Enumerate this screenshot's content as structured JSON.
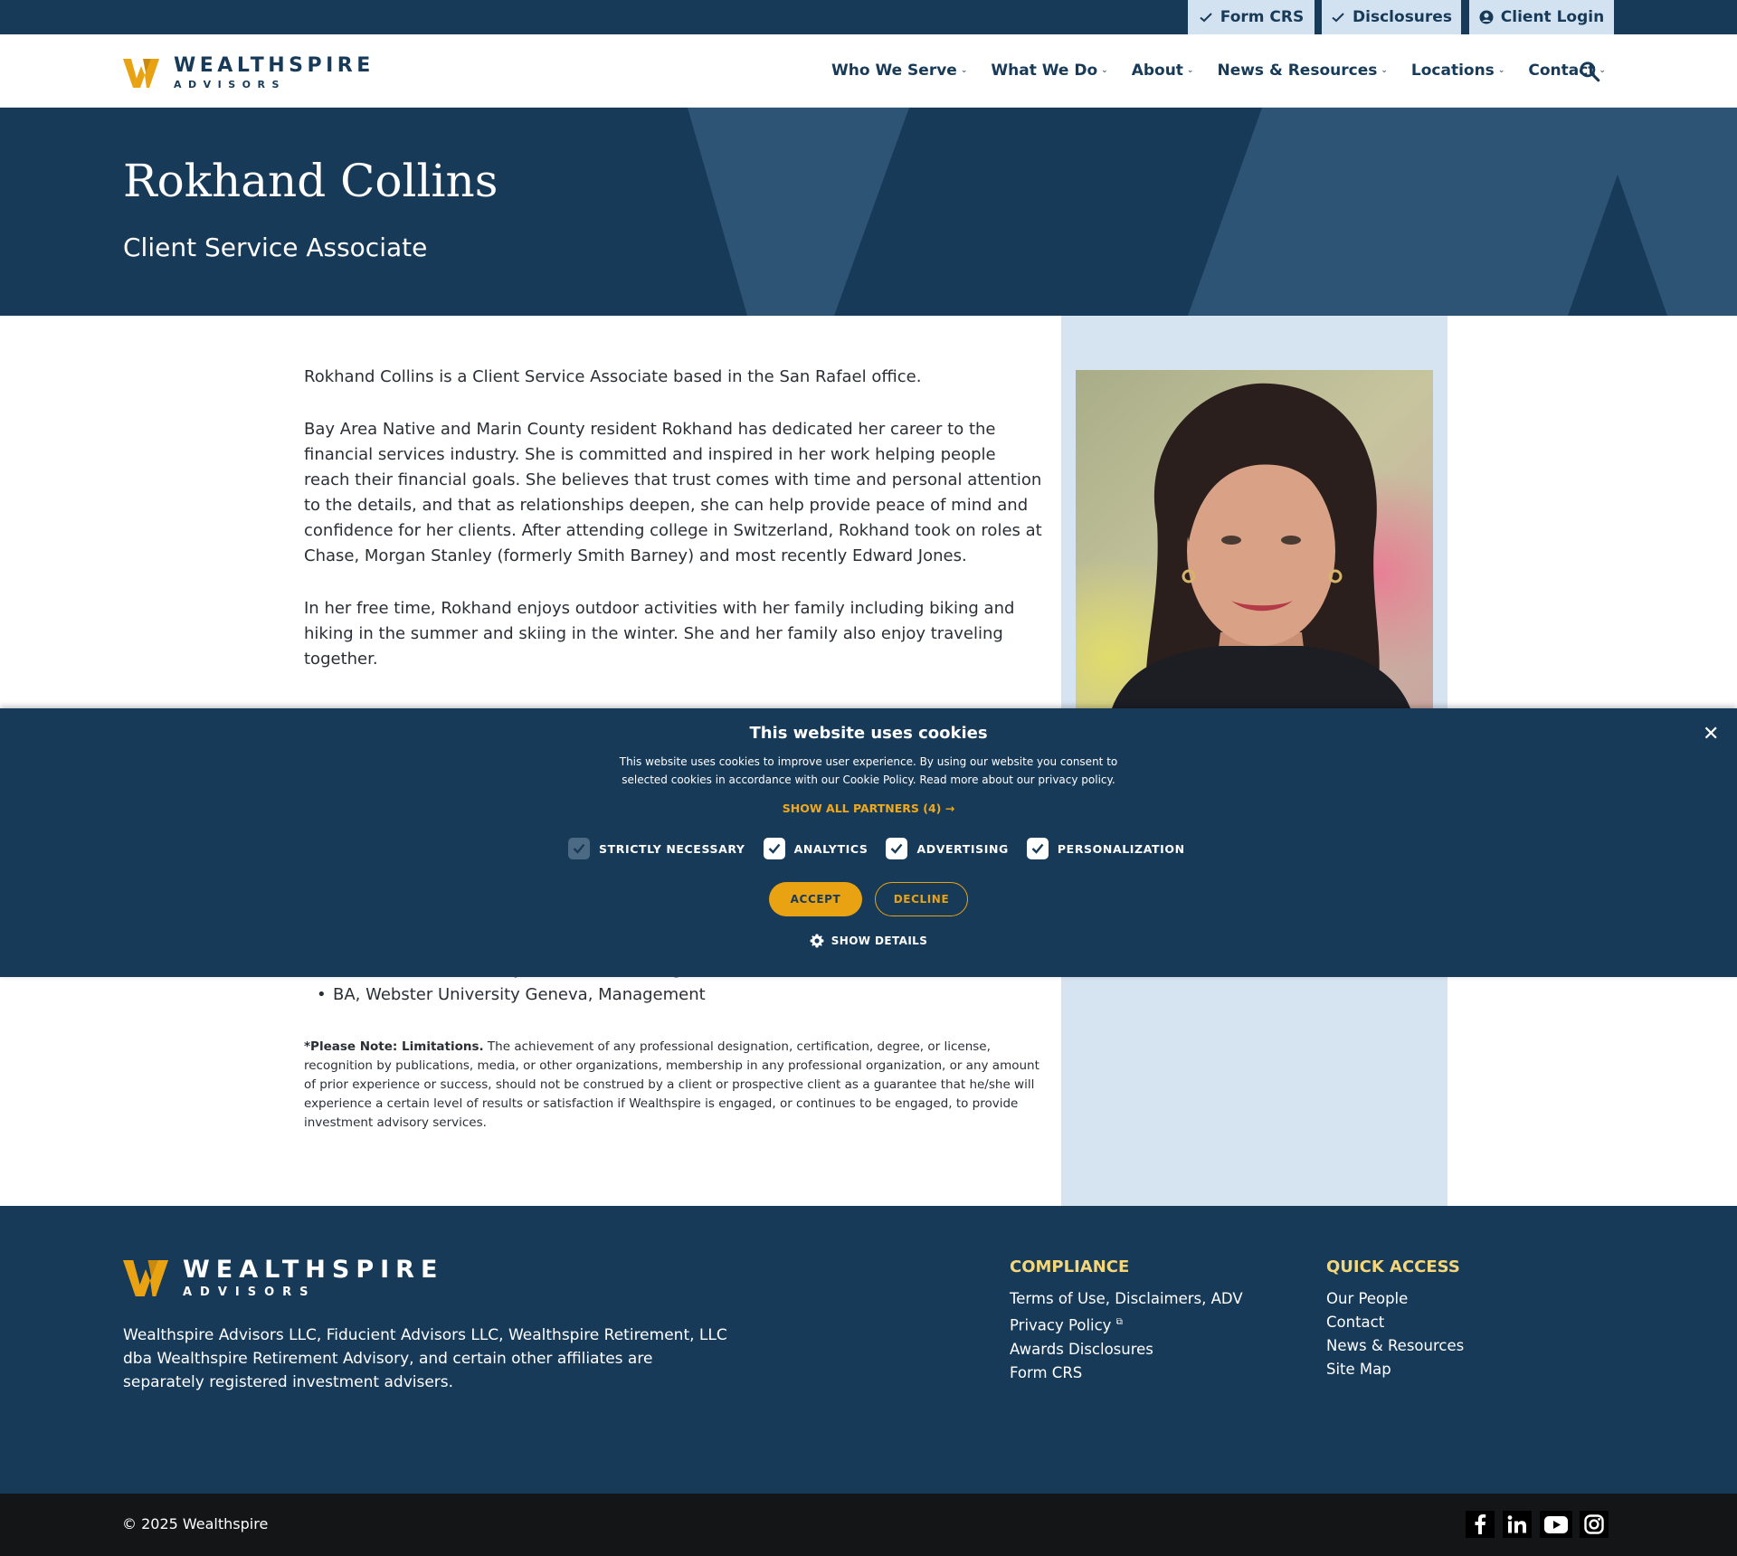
{
  "utility": {
    "form_crs": "Form CRS",
    "disclosures": "Disclosures",
    "client_login": "Client Login"
  },
  "brand": {
    "wordmark": "WEALTHSPIRE",
    "sub": "ADVISORS"
  },
  "nav": {
    "items": [
      {
        "label": "Who We Serve",
        "icon": "chevron-down-icon"
      },
      {
        "label": "What We Do",
        "icon": "chevron-down-icon"
      },
      {
        "label": "About",
        "icon": "chevron-down-icon"
      },
      {
        "label": "News & Resources",
        "icon": "chevron-down-icon"
      },
      {
        "label": "Locations",
        "icon": "chevron-down-icon"
      },
      {
        "label": "Contact",
        "icon": "chevron-down-icon"
      }
    ],
    "search_icon": "search-icon"
  },
  "hero": {
    "name": "Rokhand Collins",
    "title": "Client Service Associate"
  },
  "bio": {
    "p1": "Rokhand Collins is a Client Service Associate based in the San Rafael office.",
    "p2": "Bay Area Native and Marin County resident Rokhand has dedicated her career to the financial services industry. She is committed and inspired in her work helping people reach their financial goals. She believes that trust comes with time and personal attention to the details, and that as relationships deepen, she can help provide peace of mind and confidence for her clients. After attending college in Switzerland, Rokhand took on roles at Chase, Morgan Stanley (formerly Smith Barney) and most recently Edward Jones.",
    "p3": "In her free time, Rokhand enjoys outdoor activities with her family including biking and hiking in the summer and skiing in the winter. She and her family also enjoy traveling together."
  },
  "education": [
    "MA, Webster University Geneva, Marketing",
    "BA, Webster University Geneva, Management"
  ],
  "note": {
    "label": "*Please Note: Limitations.",
    "text": " The achievement of any professional designation, certification, degree, or license, recognition by publications, media, or other organizations, membership in any professional organization, or any amount of prior experience or success, should not be construed by a client or prospective client as a guarantee that he/she will experience a certain level of results or satisfaction if Wealthspire is engaged, or continues to be engaged, to provide investment advisory services."
  },
  "cookie": {
    "title": "This website uses cookies",
    "text": "This website uses cookies to improve user experience. By using our website you consent to selected cookies in accordance with our Cookie Policy. Read more about our privacy policy.",
    "partners": "SHOW ALL PARTNERS (4) →",
    "options": [
      {
        "label": "STRICTLY NECESSARY",
        "checked": true,
        "disabled": true
      },
      {
        "label": "ANALYTICS",
        "checked": true,
        "disabled": false
      },
      {
        "label": "ADVERTISING",
        "checked": true,
        "disabled": false
      },
      {
        "label": "PERSONALIZATION",
        "checked": true,
        "disabled": false
      }
    ],
    "accept": "ACCEPT",
    "decline": "DECLINE",
    "show_details": "SHOW DETAILS",
    "close": "✕"
  },
  "footer": {
    "description": "Wealthspire Advisors LLC, Fiducient Advisors LLC, Wealthspire Retirement, LLC dba Wealthspire Retirement Advisory, and certain other affiliates are separately registered investment advisers.",
    "compliance": {
      "heading": "COMPLIANCE",
      "links": [
        "Terms of Use, Disclaimers, ADV",
        "Privacy Policy",
        "Awards Disclosures",
        "Form CRS"
      ]
    },
    "quick_access": {
      "heading": "QUICK ACCESS",
      "links": [
        "Our People",
        "Contact",
        "News & Resources",
        "Site Map"
      ]
    },
    "copyright": "© 2025 Wealthspire",
    "social": [
      "facebook-icon",
      "linkedin-icon",
      "youtube-icon",
      "instagram-icon"
    ]
  },
  "colors": {
    "navy": "#173a58",
    "gold": "#e9a312",
    "light_blue": "#d6e3f0",
    "footer_heading": "#f5d77a"
  }
}
